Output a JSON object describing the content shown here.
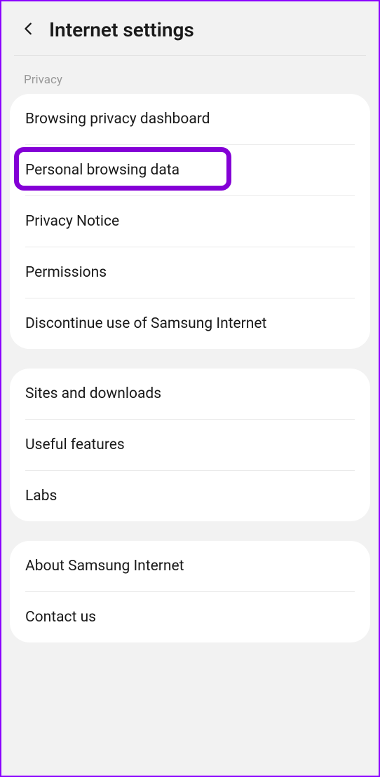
{
  "header": {
    "title": "Internet settings"
  },
  "sections": {
    "privacy": {
      "label": "Privacy",
      "items": [
        {
          "label": "Browsing privacy dashboard",
          "name": "browsing-privacy-dashboard"
        },
        {
          "label": "Personal browsing data",
          "name": "personal-browsing-data",
          "highlighted": true
        },
        {
          "label": "Privacy Notice",
          "name": "privacy-notice"
        },
        {
          "label": "Permissions",
          "name": "permissions"
        },
        {
          "label": "Discontinue use of Samsung Internet",
          "name": "discontinue-samsung-internet"
        }
      ]
    },
    "group2": {
      "items": [
        {
          "label": "Sites and downloads",
          "name": "sites-and-downloads"
        },
        {
          "label": "Useful features",
          "name": "useful-features"
        },
        {
          "label": "Labs",
          "name": "labs"
        }
      ]
    },
    "group3": {
      "items": [
        {
          "label": "About Samsung Internet",
          "name": "about-samsung-internet"
        },
        {
          "label": "Contact us",
          "name": "contact-us"
        }
      ]
    }
  }
}
